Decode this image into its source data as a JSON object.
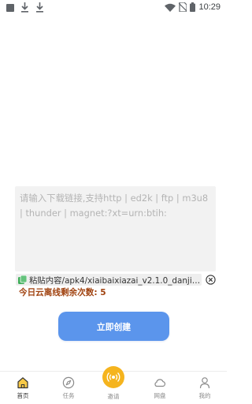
{
  "status_bar": {
    "time": "10:29",
    "icons": [
      "notification-square-icon",
      "download-icon",
      "download-icon",
      "wifi-icon",
      "no-sim-icon",
      "battery-icon"
    ]
  },
  "link_input": {
    "placeholder": "请输入下载链接,支持http | ed2k | ftp | m3u8 | thunder | magnet:?xt=urn:btih:"
  },
  "paste": {
    "text": "粘贴内容/apk4/xiaibaixiazai_v2.1.0_danji100...",
    "icon": "clipboard-icon",
    "clear_icon": "close-circle-icon"
  },
  "remaining": {
    "text": "今日云离线剩余次数: 5"
  },
  "create_button": {
    "label": "立即创建"
  },
  "nav": {
    "items": [
      {
        "label": "首页",
        "icon": "home-icon"
      },
      {
        "label": "任务",
        "icon": "compass-icon"
      },
      {
        "label": "邀请",
        "icon": "broadcast-icon"
      },
      {
        "label": "网盘",
        "icon": "cloud-icon"
      },
      {
        "label": "我的",
        "icon": "person-icon"
      }
    ]
  },
  "colors": {
    "accent_blue": "#5b95ec",
    "accent_yellow": "#f5b41e",
    "remaining_text": "#a0420f"
  }
}
